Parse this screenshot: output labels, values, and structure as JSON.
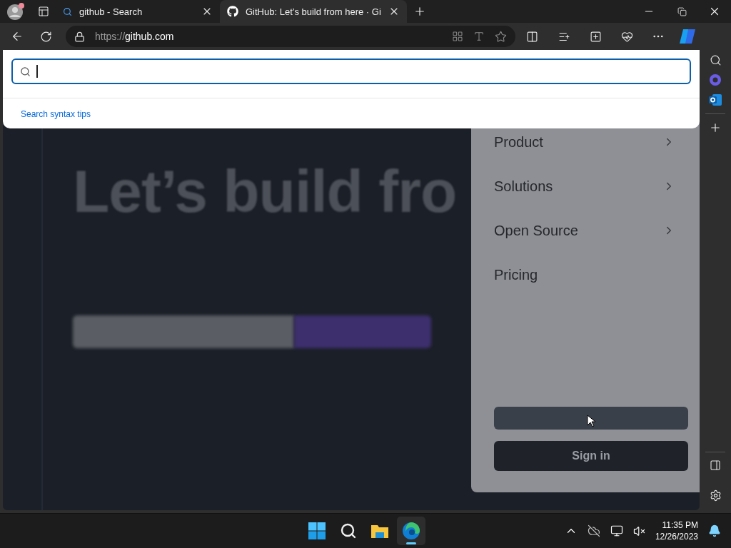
{
  "tabs": [
    {
      "kind": "search",
      "title": "github - Search",
      "selected": false
    },
    {
      "kind": "github",
      "title": "GitHub: Let’s build from here · Gi",
      "selected": true
    }
  ],
  "address": {
    "scheme": "https://",
    "host": "github.com"
  },
  "search": {
    "link": "Search syntax tips"
  },
  "hero": {
    "headline": "Let’s build fro"
  },
  "menu": [
    {
      "kind": "submenu",
      "label": "Product"
    },
    {
      "kind": "submenu",
      "label": "Solutions"
    },
    {
      "kind": "submenu",
      "label": "Open Source"
    },
    {
      "kind": "link",
      "label": "Pricing"
    }
  ],
  "actions": [
    {
      "kind": "blank"
    },
    {
      "kind": "primary",
      "label": "Sign in"
    }
  ],
  "taskbar": {
    "apps": [
      {
        "kind": "start",
        "selected": false
      },
      {
        "kind": "search",
        "selected": false
      },
      {
        "kind": "files",
        "selected": false
      },
      {
        "kind": "edge",
        "selected": true
      }
    ],
    "time": "11:35 PM",
    "date": "12/26/2023"
  }
}
